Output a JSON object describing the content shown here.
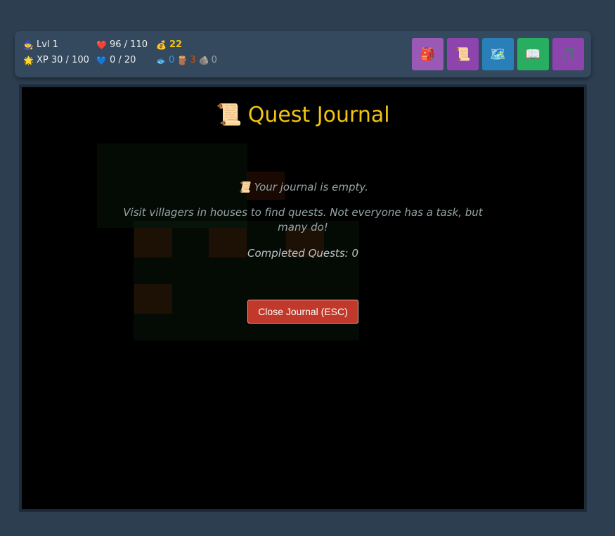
{
  "hud": {
    "level_icon": "wizard-icon",
    "level": "Lvl 1",
    "xp_icon": "sun-icon",
    "xp": "XP 30 / 100",
    "health_icon": "heart-icon",
    "health": "96 / 110",
    "mana_icon": "blue-heart-icon",
    "mana": "0 / 20",
    "gold_icon": "money-bag-icon",
    "gold": "22",
    "resources": {
      "fish_icon": "fish-icon",
      "fish": "0",
      "wood_icon": "log-icon",
      "wood": "3",
      "stone_icon": "rock-icon",
      "stone": "0"
    }
  },
  "toolbar": [
    {
      "name": "backpack-button",
      "icon": "backpack-icon",
      "glyph": "🎒",
      "color": "#9b59b6"
    },
    {
      "name": "journal-button",
      "icon": "scroll-icon",
      "glyph": "📜",
      "color": "#8e44ad"
    },
    {
      "name": "map-button",
      "icon": "map-icon",
      "glyph": "🗺️",
      "color": "#2980b9"
    },
    {
      "name": "book-button",
      "icon": "book-icon",
      "glyph": "📖",
      "color": "#27ae60"
    },
    {
      "name": "music-button",
      "icon": "music-note-icon",
      "glyph": "🎵",
      "color": "#8e44ad"
    }
  ],
  "journal": {
    "title_icon": "scroll-icon",
    "title": "Quest Journal",
    "empty_icon": "scroll-icon",
    "empty": "Your journal is empty.",
    "hint": "Visit villagers in houses to find quests. Not everyone has a task, but many do!",
    "completed": "Completed Quests: 0",
    "close_label": "Close Journal (ESC)"
  },
  "colors": {
    "background": "#2c3e50",
    "hud": "#34495e",
    "gold": "#f1c40f",
    "close_button": "#c0392b"
  }
}
